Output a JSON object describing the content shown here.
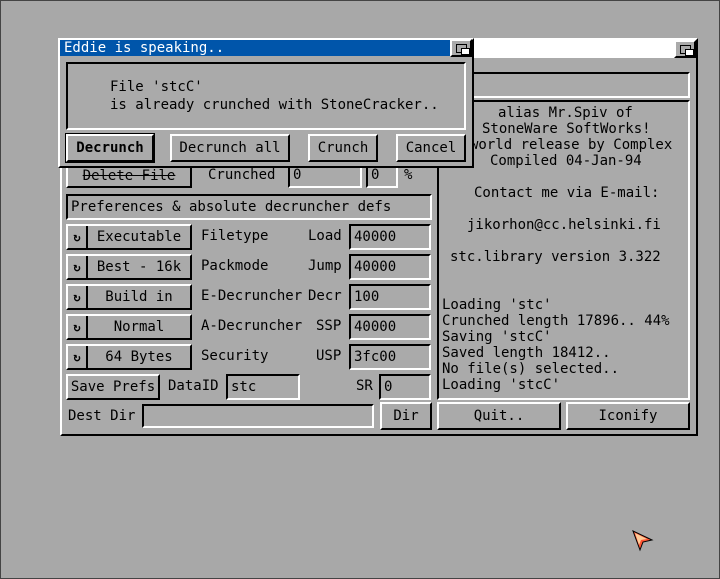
{
  "main_window": {
    "prefs_header": "Preferences & absolute decruncher defs",
    "delete_file_label": "Delete File",
    "crunched_label": "Crunched",
    "crunched_value": "0",
    "percent_value": "0",
    "percent_sign": "%",
    "rows": [
      {
        "cycle": "Executable",
        "label": "Filetype",
        "field_label": "Load",
        "value": "40000"
      },
      {
        "cycle": "Best - 16k",
        "label": "Packmode",
        "field_label": "Jump",
        "value": "40000"
      },
      {
        "cycle": "Build in",
        "label": "E-Decruncher",
        "field_label": "Decr",
        "value": "100"
      },
      {
        "cycle": "Normal",
        "label": "A-Decruncher",
        "field_label": "SSP",
        "value": "40000"
      },
      {
        "cycle": "64 Bytes",
        "label": "Security",
        "field_label": "USP",
        "value": "3fc00"
      }
    ],
    "save_prefs_label": "Save Prefs",
    "dataid_label": "DataID",
    "dataid_value": "stc",
    "sr_label": "SR",
    "sr_value": "0",
    "dest_dir_label": "Dest Dir",
    "dest_dir_value": "",
    "dir_button": "Dir",
    "quit_button": "Quit..",
    "iconify_button": "Iconify",
    "info": {
      "line1": "alias Mr.Spiv of",
      "line2": "StoneWare SoftWorks!",
      "line3": "world release by Complex",
      "line4": "Compiled 04-Jan-94",
      "contact": "Contact me via E-mail:",
      "email": "jikorhon@cc.helsinki.fi",
      "library": "stc.library version 3.322"
    },
    "log": [
      "Loading 'stc'",
      "Crunched length 17896.. 44%",
      "Saving 'stcC'",
      "Saved length 18412..",
      "No file(s) selected..",
      "Loading 'stcC'"
    ]
  },
  "dialog": {
    "title": "Eddie is speaking..",
    "message_line1": "File 'stcC'",
    "message_line2": "is already crunched with StoneCracker..",
    "buttons": {
      "decrunch": "Decrunch",
      "decrunch_all": "Decrunch all",
      "crunch": "Crunch",
      "cancel": "Cancel"
    }
  },
  "colors": {
    "desktop": "#a8a8a8",
    "window_bg": "#aaaaaa",
    "titlebar_active": "#0055aa",
    "titlebar_inactive": "#ffffff",
    "pointer": "#ff5533"
  }
}
